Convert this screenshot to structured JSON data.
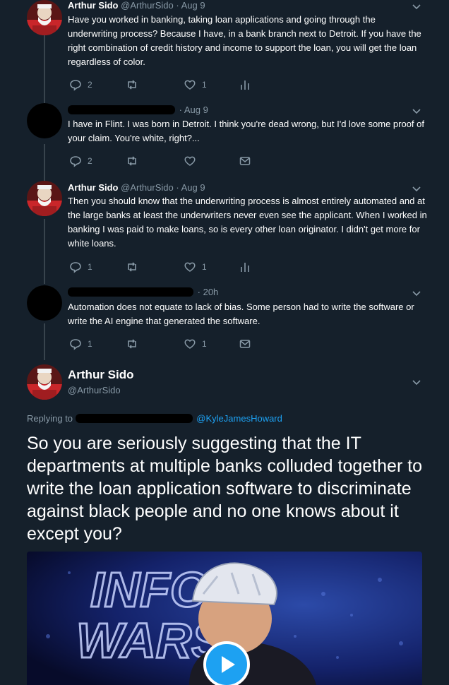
{
  "colors": {
    "background": "#15202b",
    "text": "#ffffff",
    "muted": "#8899a6",
    "accent": "#1da1f2",
    "thread_line": "#38444d"
  },
  "tweets": [
    {
      "name": "Arthur Sido",
      "handle": "@ArthurSido",
      "time": "Aug 9",
      "text": "Have you worked in banking, taking loan applications and going through the underwriting process? Because I have, in a bank branch next to Detroit. If you have the right combination of credit history and income to support the loan, you will get the loan regardless of color.",
      "reply_count": "2",
      "retweet_count": "",
      "like_count": "1",
      "last_action_icon": "analytics-icon"
    },
    {
      "name": "",
      "handle": "",
      "time": "Aug 9",
      "text": "I have in Flint.  I was born in Detroit. I think you're dead wrong, but I'd love some proof of your claim. You're white, right?...",
      "reply_count": "2",
      "retweet_count": "",
      "like_count": "",
      "last_action_icon": "message-icon"
    },
    {
      "name": "Arthur Sido",
      "handle": "@ArthurSido",
      "time": "Aug 9",
      "text": "Then you should know that the underwriting process is almost entirely automated and at the large banks at least the underwriters never even see the applicant. When I worked in banking I was paid to make loans, so is every other loan originator. I didn't get more for white loans.",
      "reply_count": "1",
      "retweet_count": "",
      "like_count": "1",
      "last_action_icon": "analytics-icon"
    },
    {
      "name": "",
      "handle": "",
      "time": "20h",
      "text": "Automation does not equate to lack of bias. Some person had to write the software or write the AI engine that generated the software.",
      "reply_count": "1",
      "retweet_count": "",
      "like_count": "1",
      "last_action_icon": "message-icon"
    }
  ],
  "main_tweet": {
    "name": "Arthur Sido",
    "handle": "@ArthurSido",
    "replying_label": "Replying to",
    "replying_handle": "@KyleJamesHoward",
    "text": "So you are seriously suggesting that the IT departments at multiple banks colluded together to write the loan application software to discriminate against black people and no one knows about it except you?"
  },
  "media": {
    "watermark": "INFO WARS",
    "play_icon": "play-icon"
  }
}
